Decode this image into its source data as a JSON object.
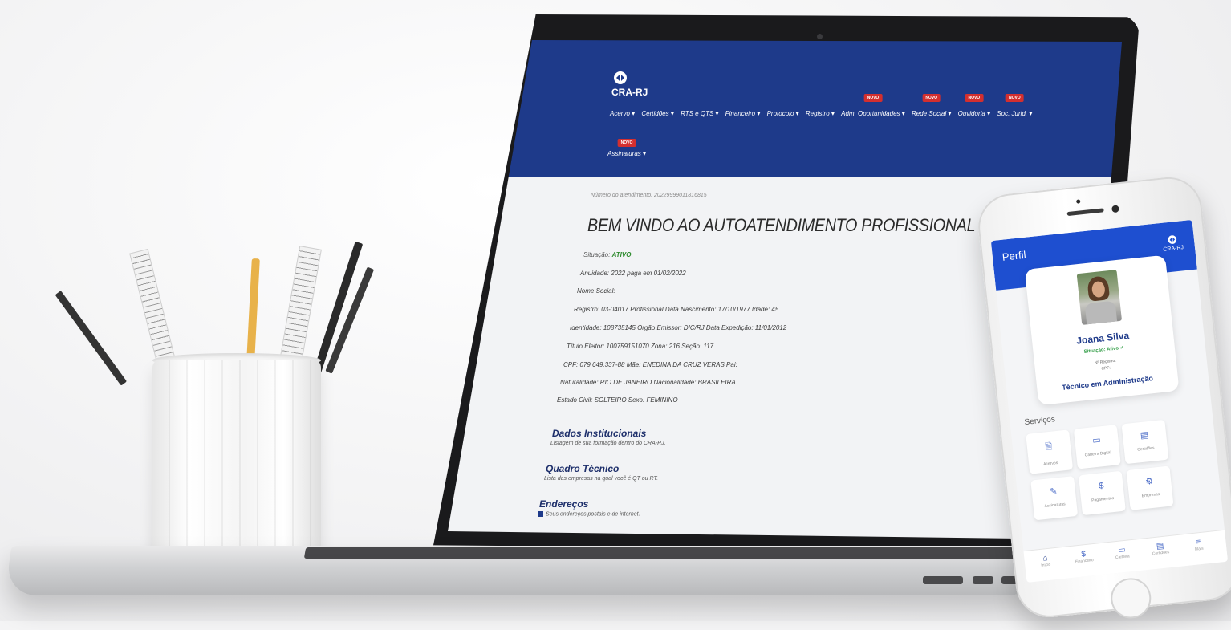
{
  "laptop": {
    "logo_text": "CRA-RJ",
    "nav_items": [
      {
        "label": "Acervo ▾",
        "badge": ""
      },
      {
        "label": "Certidões ▾",
        "badge": ""
      },
      {
        "label": "RTS e QTS ▾",
        "badge": ""
      },
      {
        "label": "Financeiro ▾",
        "badge": ""
      },
      {
        "label": "Protocolo ▾",
        "badge": ""
      },
      {
        "label": "Registro ▾",
        "badge": ""
      },
      {
        "label": "Adm. Oportunidades ▾",
        "badge": "NOVO"
      },
      {
        "label": "Rede Social ▾",
        "badge": "NOVO"
      },
      {
        "label": "Ouvidoria ▾",
        "badge": "NOVO"
      },
      {
        "label": "Soc. Jurid. ▾",
        "badge": "NOVO"
      }
    ],
    "nav_row2": {
      "label": "Assinaturas ▾",
      "badge": "NOVO"
    },
    "atendimento": "Número do atendimento: 20229999011816815",
    "welcome": "BEM VINDO AO AUTOATENDIMENTO PROFISSIONAL CRA-RJ",
    "info": {
      "situacao_label": "Situação:",
      "situacao_value": "ATIVO",
      "anuidade": "Anuidade: 2022 paga em 01/02/2022",
      "nome_social": "Nome Social:",
      "registro": "Registro: 03-04017 Profissional Data Nascimento: 17/10/1977 Idade: 45",
      "identidade": "Identidade: 108735145 Orgão Emissor: DIC/RJ Data Expedição: 11/01/2012",
      "titulo": "Título Eleitor: 100759151070 Zona: 216 Seção: 117",
      "cpf": "CPF: 079.649.337-88 Mãe: ENEDINA DA CRUZ VERAS Pai:",
      "naturalidade": "Naturalidade: RIO DE JANEIRO Nacionalidade: BRASILEIRA",
      "estado_civil": "Estado Civil: SOLTEIRO Sexo: FEMININO"
    },
    "sections": [
      {
        "title": "Dados Institucionais",
        "subtitle": "Listagem de sua formação dentro do CRA-RJ."
      },
      {
        "title": "Quadro Técnico",
        "subtitle": "Lista das empresas na qual você é QT ou RT."
      },
      {
        "title": "Endereços",
        "subtitle": "Seus endereços postais e de internet."
      }
    ]
  },
  "phone": {
    "header_title": "Perfil",
    "logo_text": "CRA-RJ",
    "name": "Joana Silva",
    "situacao": "Situação: Ativo ✔",
    "registro": "Nº Registro:",
    "cpf": "CPF:",
    "title": "Técnico em Administração",
    "services_label": "Serviços",
    "tiles": [
      {
        "icon": "🗎",
        "label": "Acervos"
      },
      {
        "icon": "▭",
        "label": "Carteira Digital"
      },
      {
        "icon": "▤",
        "label": "Certidões"
      },
      {
        "icon": "✎",
        "label": "Assinaturas"
      },
      {
        "icon": "$",
        "label": "Pagamentos"
      },
      {
        "icon": "⚙",
        "label": "Empresas"
      }
    ],
    "bottom_nav": [
      {
        "icon": "⌂",
        "label": "Início"
      },
      {
        "icon": "$",
        "label": "Financeiro"
      },
      {
        "icon": "▭",
        "label": "Carteira"
      },
      {
        "icon": "▤",
        "label": "Certidões"
      },
      {
        "icon": "≡",
        "label": "Mais"
      }
    ]
  }
}
